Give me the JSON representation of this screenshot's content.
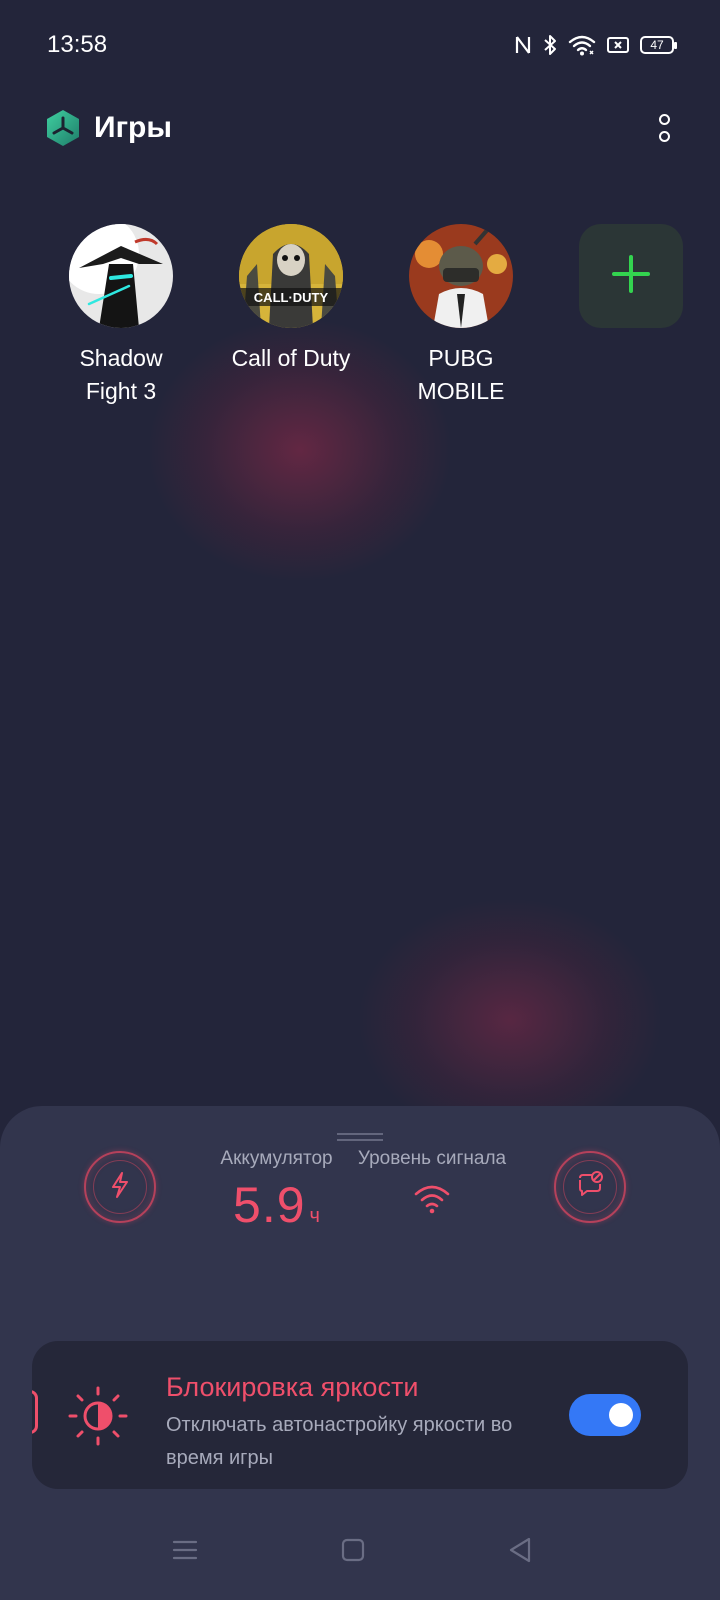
{
  "status_bar": {
    "time": "13:58",
    "battery_level": "47"
  },
  "header": {
    "title": "Игры"
  },
  "games": [
    {
      "label_line1": "Shadow",
      "label_line2": "Fight 3"
    },
    {
      "label_line1": "Call of Duty",
      "label_line2": ""
    },
    {
      "label_line1": "PUBG",
      "label_line2": "MOBILE"
    }
  ],
  "game_art": {
    "cod_logo_text": "CALL·DUTY"
  },
  "sheet": {
    "battery_label": "Аккумулятор",
    "battery_value": "5.9",
    "battery_unit": "ч",
    "signal_label": "Уровень сигнала",
    "brightness_card": {
      "title": "Блокировка яркости",
      "description": "Отключать автонастройку яркости во время игры",
      "toggle_on": true
    }
  },
  "colors": {
    "accent_red": "#ef4f6b",
    "toggle_blue": "#3478f6",
    "add_green": "#33d44f"
  },
  "icons": [
    "nfc-icon",
    "bluetooth-icon",
    "wifi-icon",
    "no-sim-icon",
    "battery-icon",
    "game-space-logo-icon",
    "more-icon",
    "add-icon",
    "lightning-icon",
    "signal-icon",
    "notification-block-icon",
    "brightness-icon",
    "menu-icon",
    "home-icon",
    "back-icon"
  ]
}
